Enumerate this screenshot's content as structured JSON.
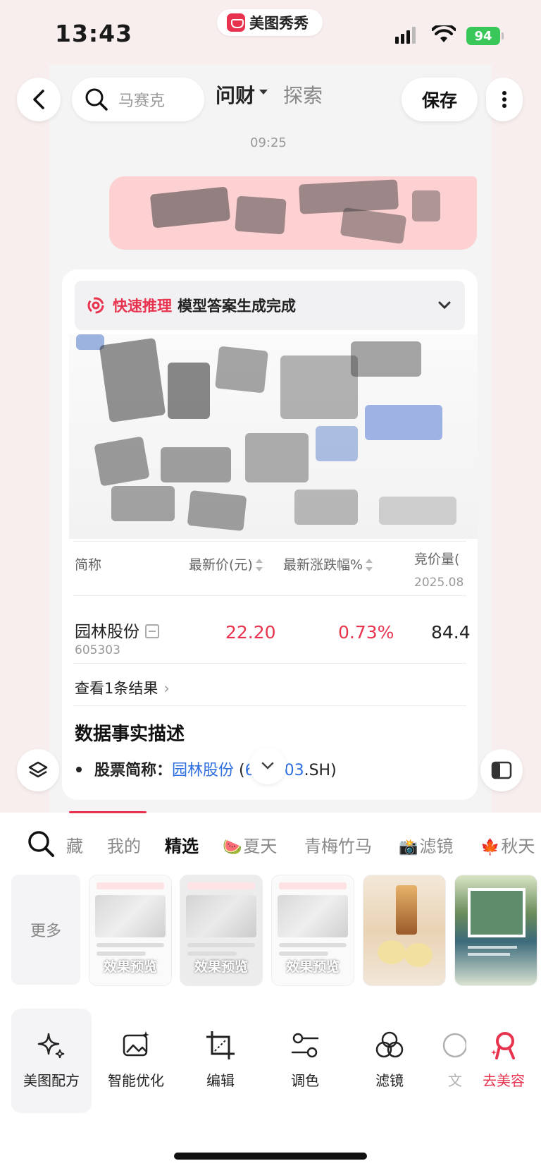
{
  "status_bar": {
    "time": "13:43",
    "battery": "94"
  },
  "app_pill": {
    "name": "美图秀秀"
  },
  "header": {
    "search_placeholder": "马赛克",
    "tab_wencai": "问财",
    "tab_explore": "探索",
    "save_label": "保存"
  },
  "chat": {
    "timestamp": "09:25",
    "inference": {
      "mode": "快速推理",
      "status": "模型答案生成完成"
    },
    "table": {
      "headers": {
        "name": "简称",
        "price": "最新价(元)",
        "change": "最新涨跌幅%",
        "volume": "竞价量(",
        "volume_sub": "2025.08"
      },
      "row": {
        "name": "园林股份",
        "code": "605303",
        "price": "22.20",
        "change": "0.73%",
        "volume": "84.4"
      }
    },
    "view_results": "查看1条结果",
    "facts_title": "数据事实描述",
    "fact": {
      "label": "股票简称：",
      "name_link": "园林股份",
      "open_paren": " (",
      "code_link": "605303",
      "suffix": ".SH)"
    }
  },
  "panel": {
    "categories": [
      "藏",
      "我的",
      "精选",
      "夏天",
      "青梅竹马",
      "滤镜",
      "秋天"
    ],
    "category_emojis": {
      "summer": "🍉",
      "filter": "📸",
      "autumn": "🍁"
    },
    "more_label": "更多",
    "preview_label": "效果预览",
    "tools": [
      "美图配方",
      "智能优化",
      "编辑",
      "调色",
      "滤镜",
      "文",
      "去美容"
    ]
  },
  "colors": {
    "accent": "#e8334f",
    "link": "#2f6fe0",
    "battery": "#39c75a"
  }
}
